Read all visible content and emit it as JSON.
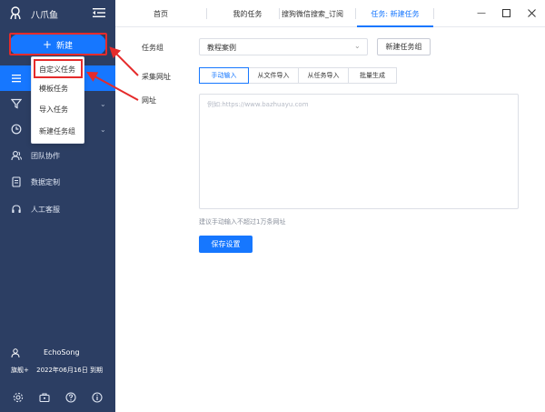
{
  "app": {
    "name": "八爪鱼"
  },
  "sidebar": {
    "new_button": "新建",
    "items": [
      {
        "label": ""
      },
      {
        "label": ""
      },
      {
        "label": ""
      },
      {
        "label": "团队协作"
      },
      {
        "label": "数据定制"
      },
      {
        "label": "人工客服"
      }
    ],
    "user": {
      "name": "EchoSong",
      "plan": "旗舰+",
      "expiry": "2022年06月16日 到期"
    }
  },
  "new_menu": {
    "items": [
      "自定义任务",
      "模板任务",
      "导入任务",
      "新建任务组"
    ]
  },
  "tabs": [
    {
      "label": "首页"
    },
    {
      "label": "我的任务"
    },
    {
      "label": "搜狗微信搜索_订阅"
    },
    {
      "label": "任务: 新建任务"
    }
  ],
  "form": {
    "group_label": "任务组",
    "group_value": "教程案例",
    "new_group_button": "新建任务组",
    "url_source_label": "采集网址",
    "modes": [
      "手动输入",
      "从文件导入",
      "从任务导入",
      "批量生成"
    ],
    "url_label": "网址",
    "url_placeholder": "例如:https://www.bazhuayu.com",
    "hint": "建议手动输入不超过1万条网址",
    "save_button": "保存设置"
  },
  "colors": {
    "sidebar_bg": "#2c3e63",
    "accent": "#1677ff",
    "annotation_red": "#e52b2b"
  }
}
